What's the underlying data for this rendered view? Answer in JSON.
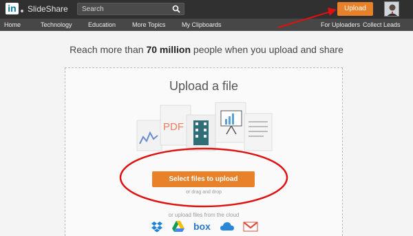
{
  "header": {
    "logo_text": "in",
    "brand": "SlideShare",
    "search_placeholder": "Search",
    "upload_label": "Upload"
  },
  "nav": {
    "home": "Home",
    "technology": "Technology",
    "education": "Education",
    "more_topics": "More Topics",
    "clipboards": "My Clipboards",
    "for_uploaders": "For Uploaders",
    "collect_leads": "Collect Leads"
  },
  "main": {
    "headline_before": "Reach more than ",
    "headline_bold": "70 million",
    "headline_after": " people when you upload and share",
    "upload_title": "Upload a file",
    "pdf_label": "PDF",
    "select_button": "Select files to upload",
    "drag_text": "or drag and drop",
    "cloud_text": "or upload files from the cloud",
    "cloud_services": [
      "dropbox-icon",
      "google-drive-icon",
      "box-icon",
      "onedrive-icon",
      "gmail-icon"
    ],
    "box_label": "box"
  },
  "colors": {
    "accent": "#e8822a",
    "topbar": "#303030",
    "navbar": "#474747",
    "annotation": "#e01010"
  }
}
